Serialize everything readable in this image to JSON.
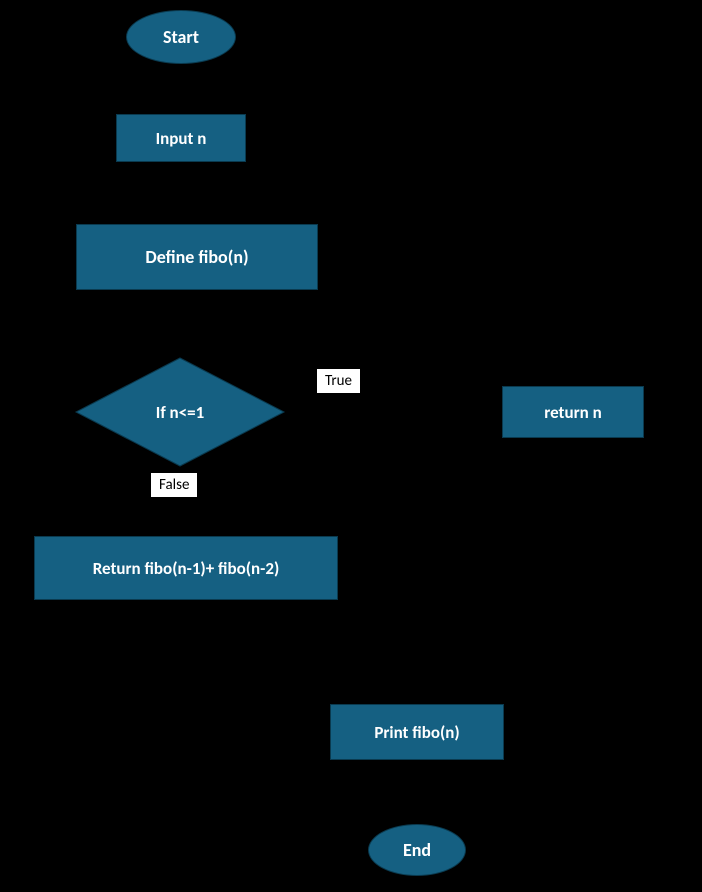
{
  "nodes": {
    "start": "Start",
    "input": "Input n",
    "define": "Define fibo(n)",
    "decision": "If n<=1",
    "returnN": "return n",
    "recurse": "Return fibo(n-1)+ fibo(n-2)",
    "print": "Print fibo(n)",
    "end": "End"
  },
  "labels": {
    "true": "True",
    "false": "False"
  },
  "colors": {
    "node_fill": "#156082",
    "node_text": "#ffffff",
    "arrow": "#000000",
    "bg": "#000000"
  }
}
